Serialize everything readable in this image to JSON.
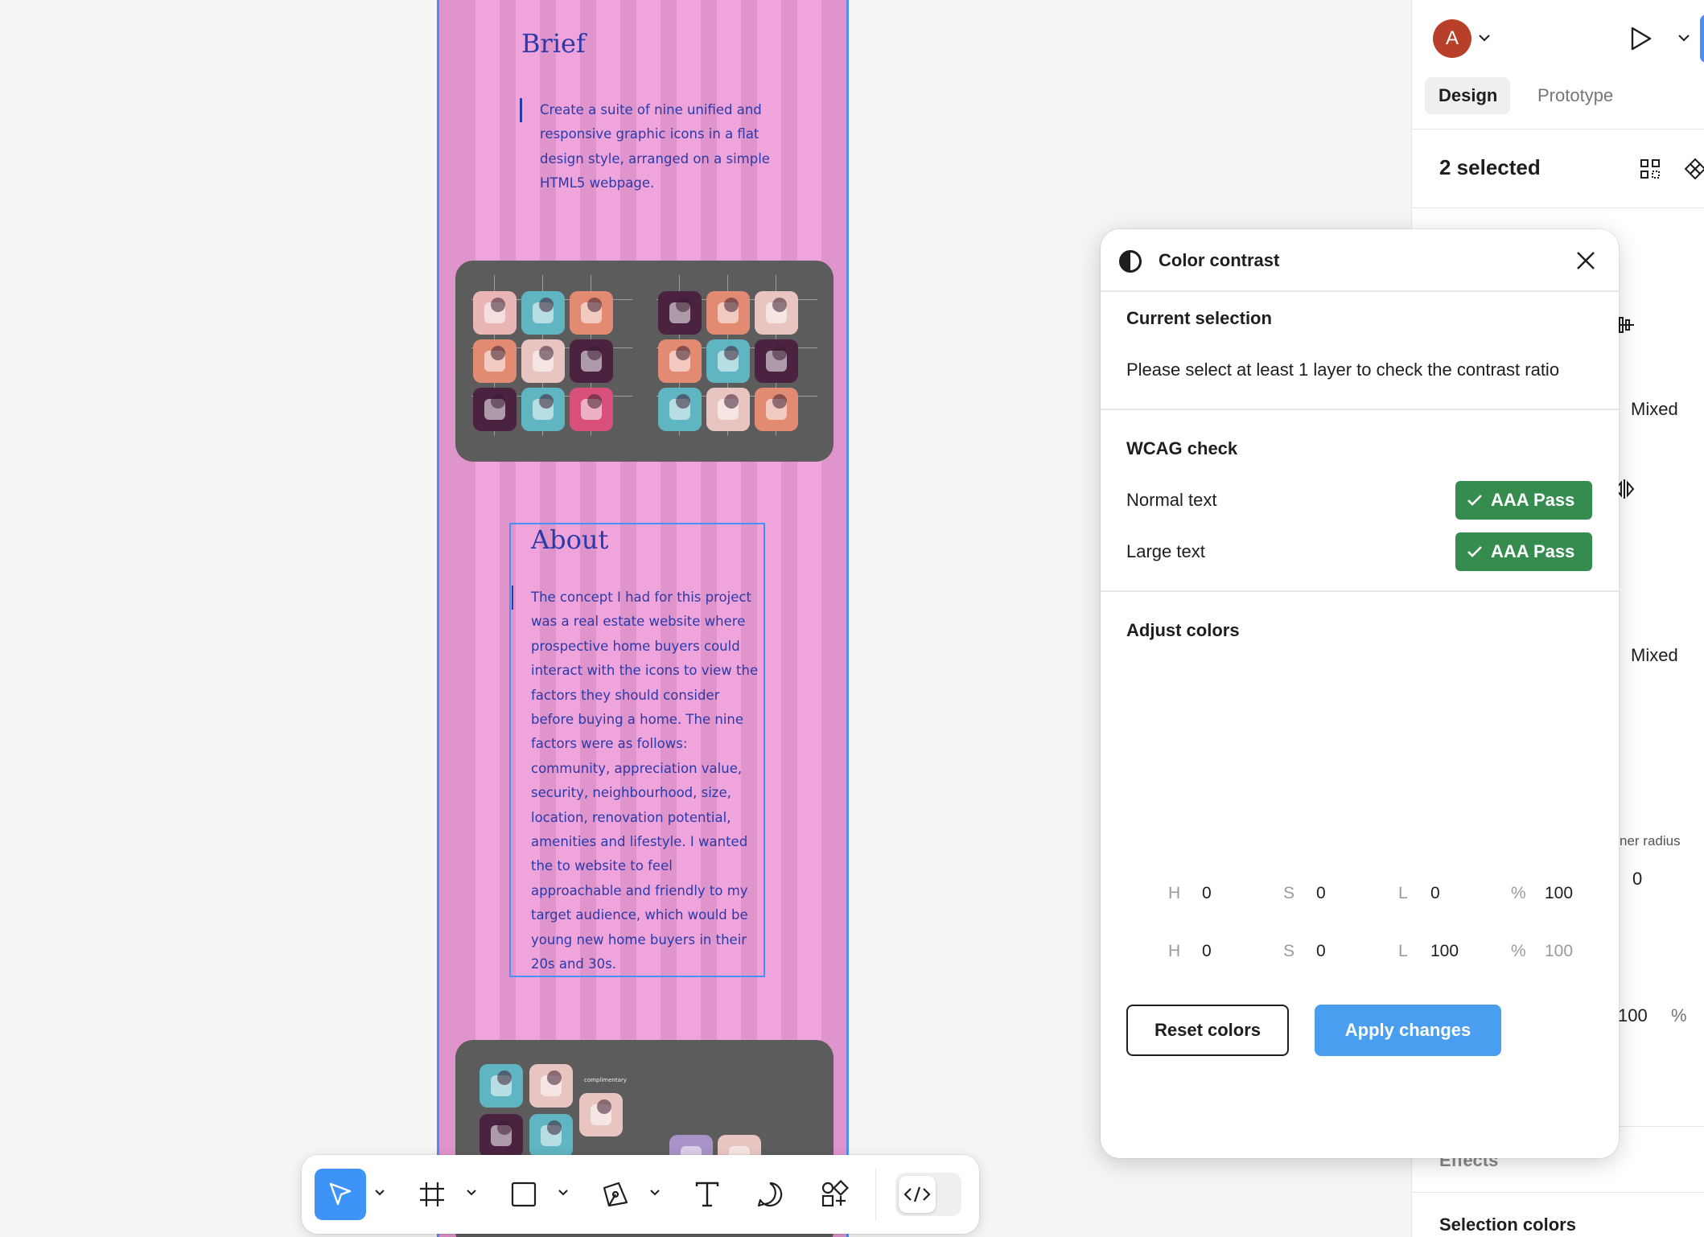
{
  "canvas": {
    "brief": {
      "title": "Brief",
      "body": "Create a suite of nine unified and\nresponsive graphic icons in a flat\ndesign style, arranged on a simple\nHTML5 webpage."
    },
    "about": {
      "title": "About",
      "body": "The concept I had for this project\nwas a real estate website where\nprospective home buyers could\ninteract with the icons to view the\nfactors they should consider\nbefore buying a home. The nine\nfactors were as follows:\ncommunity, appreciation value,\nsecurity, neighbourhood, size,\nlocation, renovation potential,\namenities and lifestyle. I wanted\nthe to website to feel\napproachable and friendly to my\ntarget audience, which would be\nyoung new home buyers in their\n20s and 30s."
    },
    "bottom_card_label": "complimentary"
  },
  "right_panel": {
    "avatar_letter": "A",
    "tabs": [
      {
        "label": "Design",
        "active": true
      },
      {
        "label": "Prototype",
        "active": false
      }
    ],
    "selection_label": "2 selected",
    "mixed_1": "Mixed",
    "mixed_2": "Mixed",
    "corner_radius_label": "ner radius",
    "corner_radius_value": "0",
    "opacity_value": "100",
    "opacity_unit": "%",
    "effects_label": "Effects",
    "selection_colors_label": "Selection colors"
  },
  "plugin": {
    "title": "Color contrast",
    "current_selection": {
      "heading": "Current selection",
      "message": "Please select at least 1 layer to check the contrast ratio"
    },
    "wcag": {
      "heading": "WCAG check",
      "rows": [
        {
          "label": "Normal text",
          "result": "AAA Pass"
        },
        {
          "label": "Large text",
          "result": "AAA Pass"
        }
      ]
    },
    "adjust": {
      "heading": "Adjust colors",
      "rows": [
        {
          "h_key": "H",
          "h": "0",
          "s_key": "S",
          "s": "0",
          "l_key": "L",
          "l": "0",
          "pct_key": "%",
          "pct": "100"
        },
        {
          "h_key": "H",
          "h": "0",
          "s_key": "S",
          "s": "0",
          "l_key": "L",
          "l": "100",
          "pct_key": "%",
          "pct": "100"
        }
      ]
    },
    "reset_label": "Reset colors",
    "apply_label": "Apply changes"
  },
  "colors": {
    "accent": "#4a8ff5",
    "pass_green": "#348c4f",
    "apply_blue": "#4a9ef0",
    "frame_pink": "#df94cb",
    "text_blue": "#2b3aa8",
    "avatar": "#b8402a"
  }
}
